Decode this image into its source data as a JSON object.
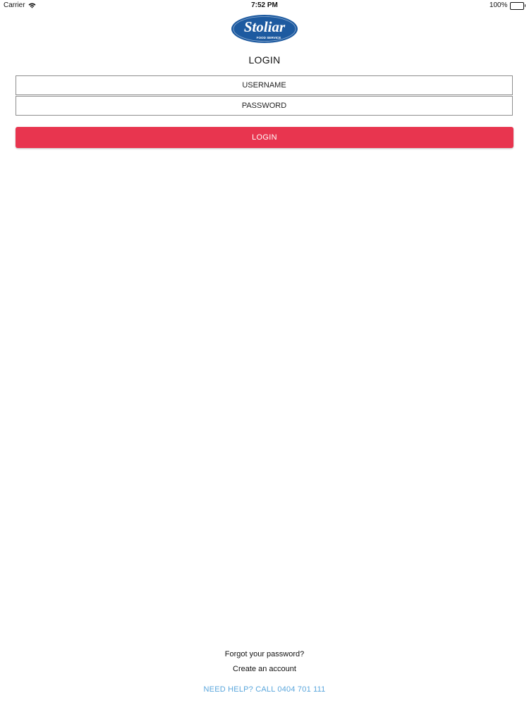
{
  "status_bar": {
    "carrier": "Carrier",
    "time": "7:52 PM",
    "battery_percent": "100%",
    "battery_level": 1.0
  },
  "logo": {
    "brand": "Stoliar",
    "tagline": "FOOD SERVICE",
    "color": "#1d5aa0"
  },
  "login_form": {
    "title": "LOGIN",
    "username_placeholder": "USERNAME",
    "password_placeholder": "PASSWORD",
    "submit_label": "LOGIN",
    "submit_color": "#e8354f"
  },
  "footer": {
    "forgot_password": "Forgot your password?",
    "create_account": "Create an account",
    "help": "NEED HELP? CALL 0404 701 111",
    "help_color": "#5aa6dc"
  }
}
